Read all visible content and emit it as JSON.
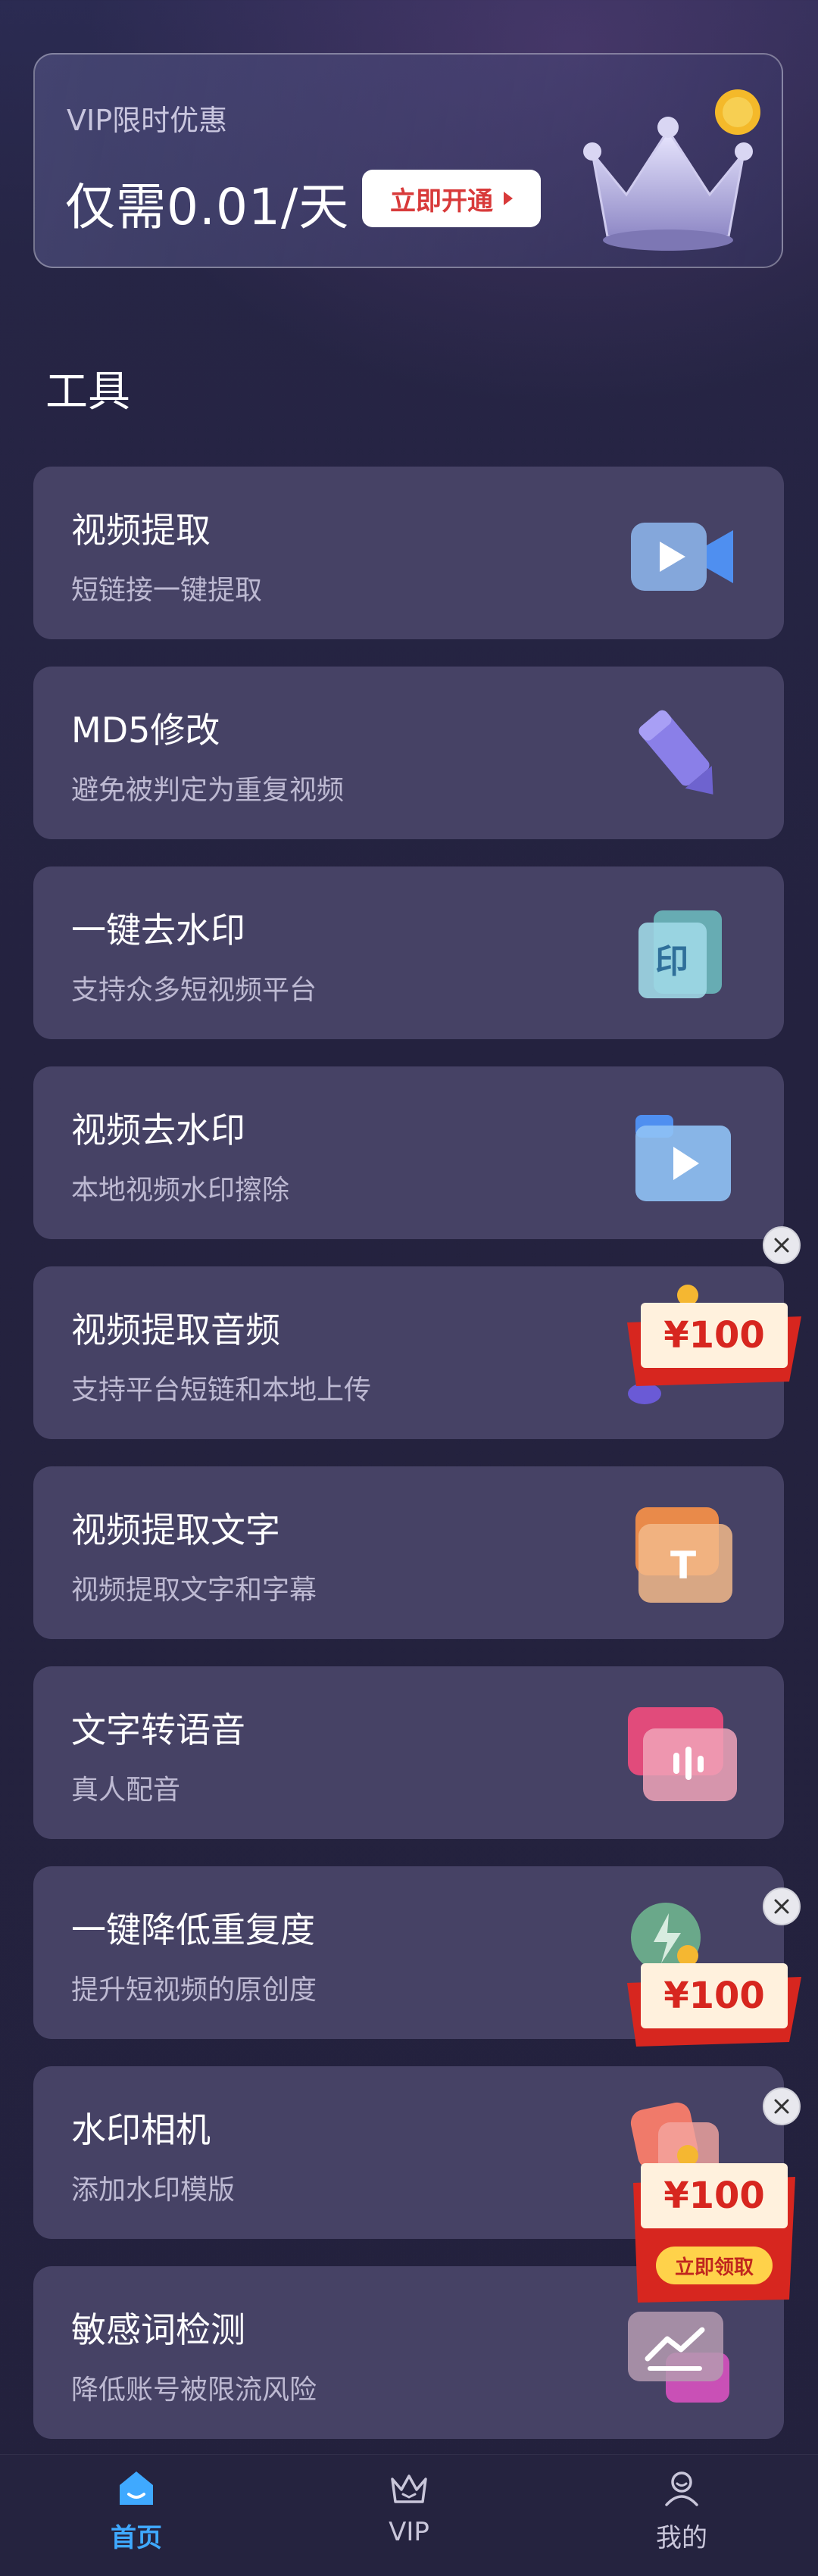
{
  "vip": {
    "subtitle": "VIP限时优惠",
    "price": "仅需0.01/天",
    "button": "立即开通"
  },
  "section_title": "工具",
  "tools": [
    {
      "title": "视频提取",
      "desc": "短链接一键提取",
      "icon": "video-camera-icon"
    },
    {
      "title": "MD5修改",
      "desc": "避免被判定为重复视频",
      "icon": "pencil-icon"
    },
    {
      "title": "一键去水印",
      "desc": "支持众多短视频平台",
      "icon": "stamp-icon"
    },
    {
      "title": "视频去水印",
      "desc": "本地视频水印擦除",
      "icon": "video-folder-icon"
    },
    {
      "title": "视频提取音频",
      "desc": "支持平台短链和本地上传",
      "icon": "audio-icon"
    },
    {
      "title": "视频提取文字",
      "desc": "视频提取文字和字幕",
      "icon": "text-icon"
    },
    {
      "title": "文字转语音",
      "desc": "真人配音",
      "icon": "voice-icon"
    },
    {
      "title": "一键降低重复度",
      "desc": "提升短视频的原创度",
      "icon": "lightning-icon"
    },
    {
      "title": "水印相机",
      "desc": "添加水印模版",
      "icon": "camera-icon"
    },
    {
      "title": "敏感词检测",
      "desc": "降低账号被限流风险",
      "icon": "chart-icon"
    }
  ],
  "coupons": [
    {
      "amount": "¥100"
    },
    {
      "amount": "¥100"
    },
    {
      "amount": "¥100",
      "button": "立即领取"
    }
  ],
  "nav": [
    {
      "label": "首页",
      "icon": "home-icon",
      "active": true
    },
    {
      "label": "VIP",
      "icon": "crown-icon",
      "active": false
    },
    {
      "label": "我的",
      "icon": "user-icon",
      "active": false
    }
  ],
  "colors": {
    "accent": "#3fa9ff",
    "card": "#464265",
    "coupon_red": "#e23b2e"
  }
}
